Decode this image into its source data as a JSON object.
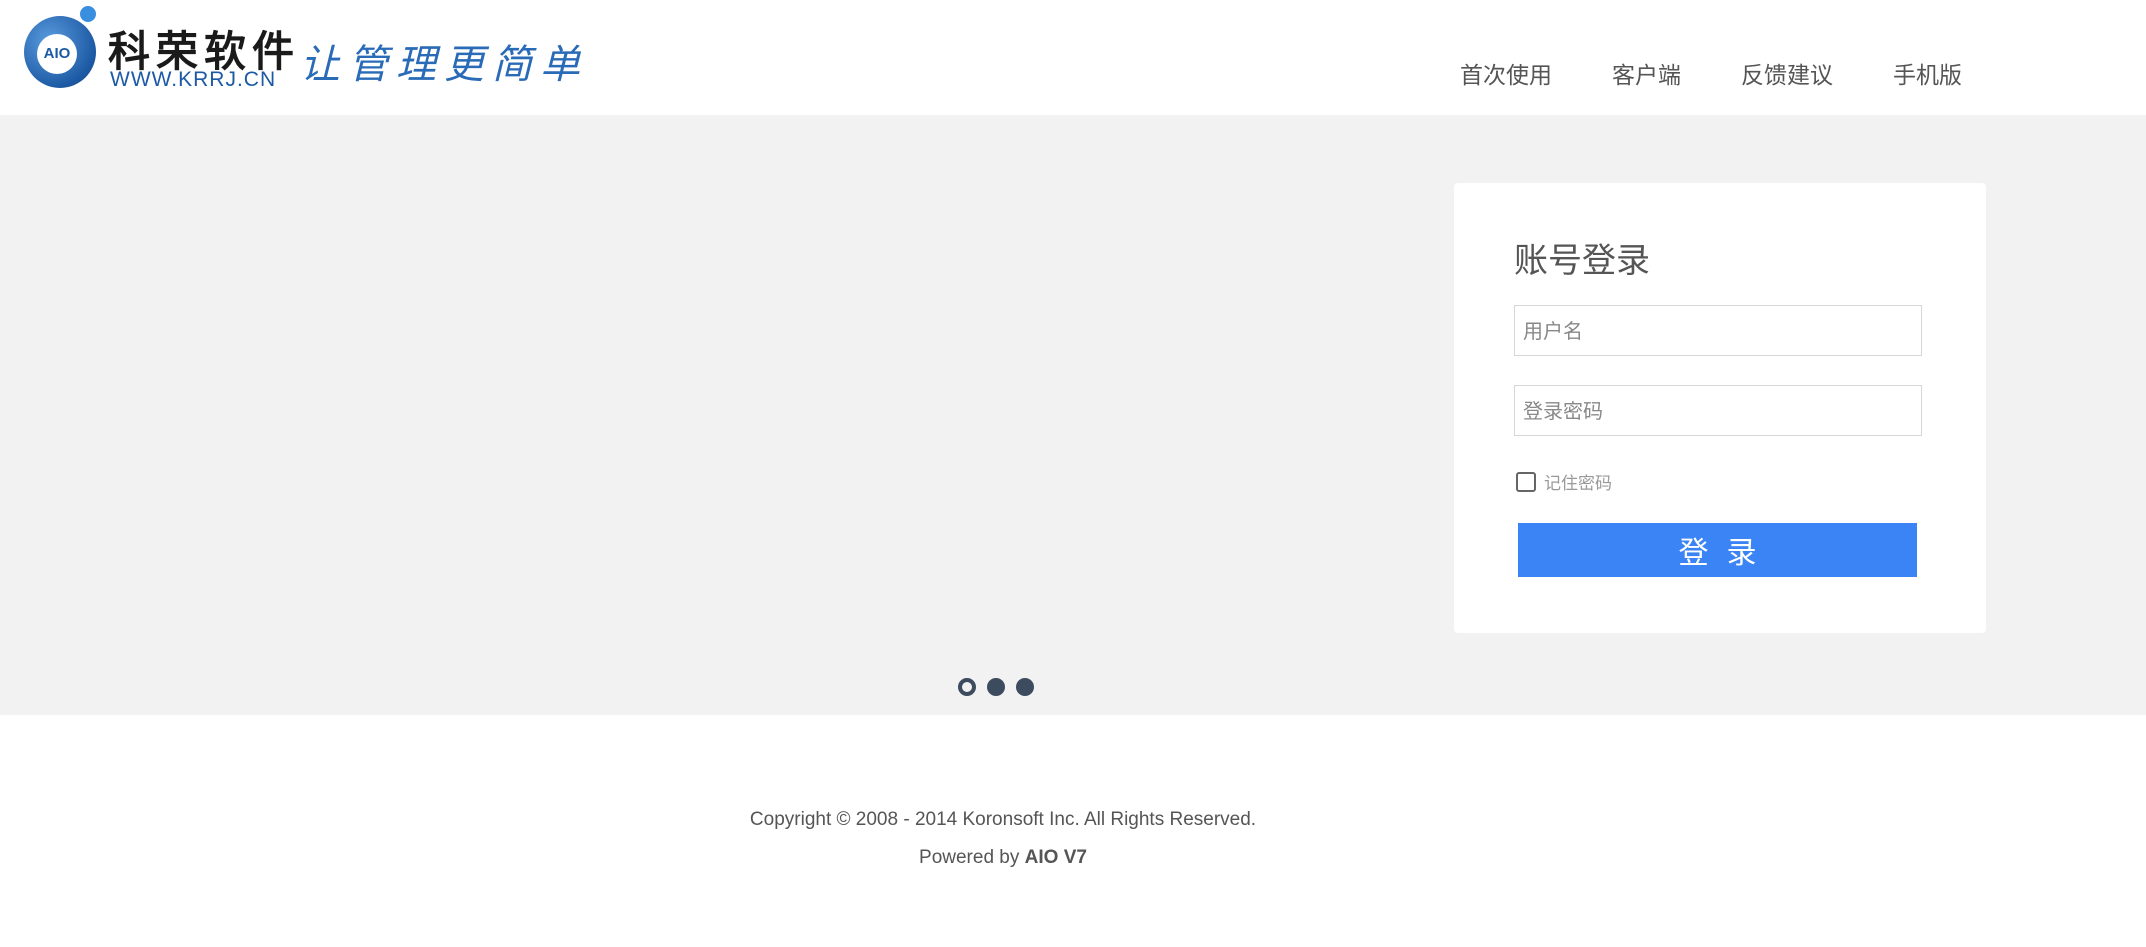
{
  "header": {
    "logo": {
      "badge": "AIO",
      "title": "科荣软件",
      "url": "WWW.KRRJ.CN",
      "slogan": "让管理更简单"
    },
    "nav": [
      {
        "label": "首次使用"
      },
      {
        "label": "客户端"
      },
      {
        "label": "反馈建议"
      },
      {
        "label": "手机版"
      }
    ]
  },
  "login": {
    "title": "账号登录",
    "username_placeholder": "用户名",
    "password_placeholder": "登录密码",
    "remember_label": "记住密码",
    "remember_checked": false,
    "submit_label": "登录"
  },
  "carousel": {
    "slide_count": 3,
    "active_index": 0
  },
  "footer": {
    "copyright": "Copyright © 2008 - 2014 Koronsoft Inc. All Rights Reserved.",
    "powered_prefix": "Powered by",
    "powered_product": "AIO V7"
  },
  "colors": {
    "accent": "#3b84f5",
    "banner_bg": "#f2f2f2",
    "dot": "#3d4b5e",
    "brand_blue": "#1d5aa5"
  }
}
